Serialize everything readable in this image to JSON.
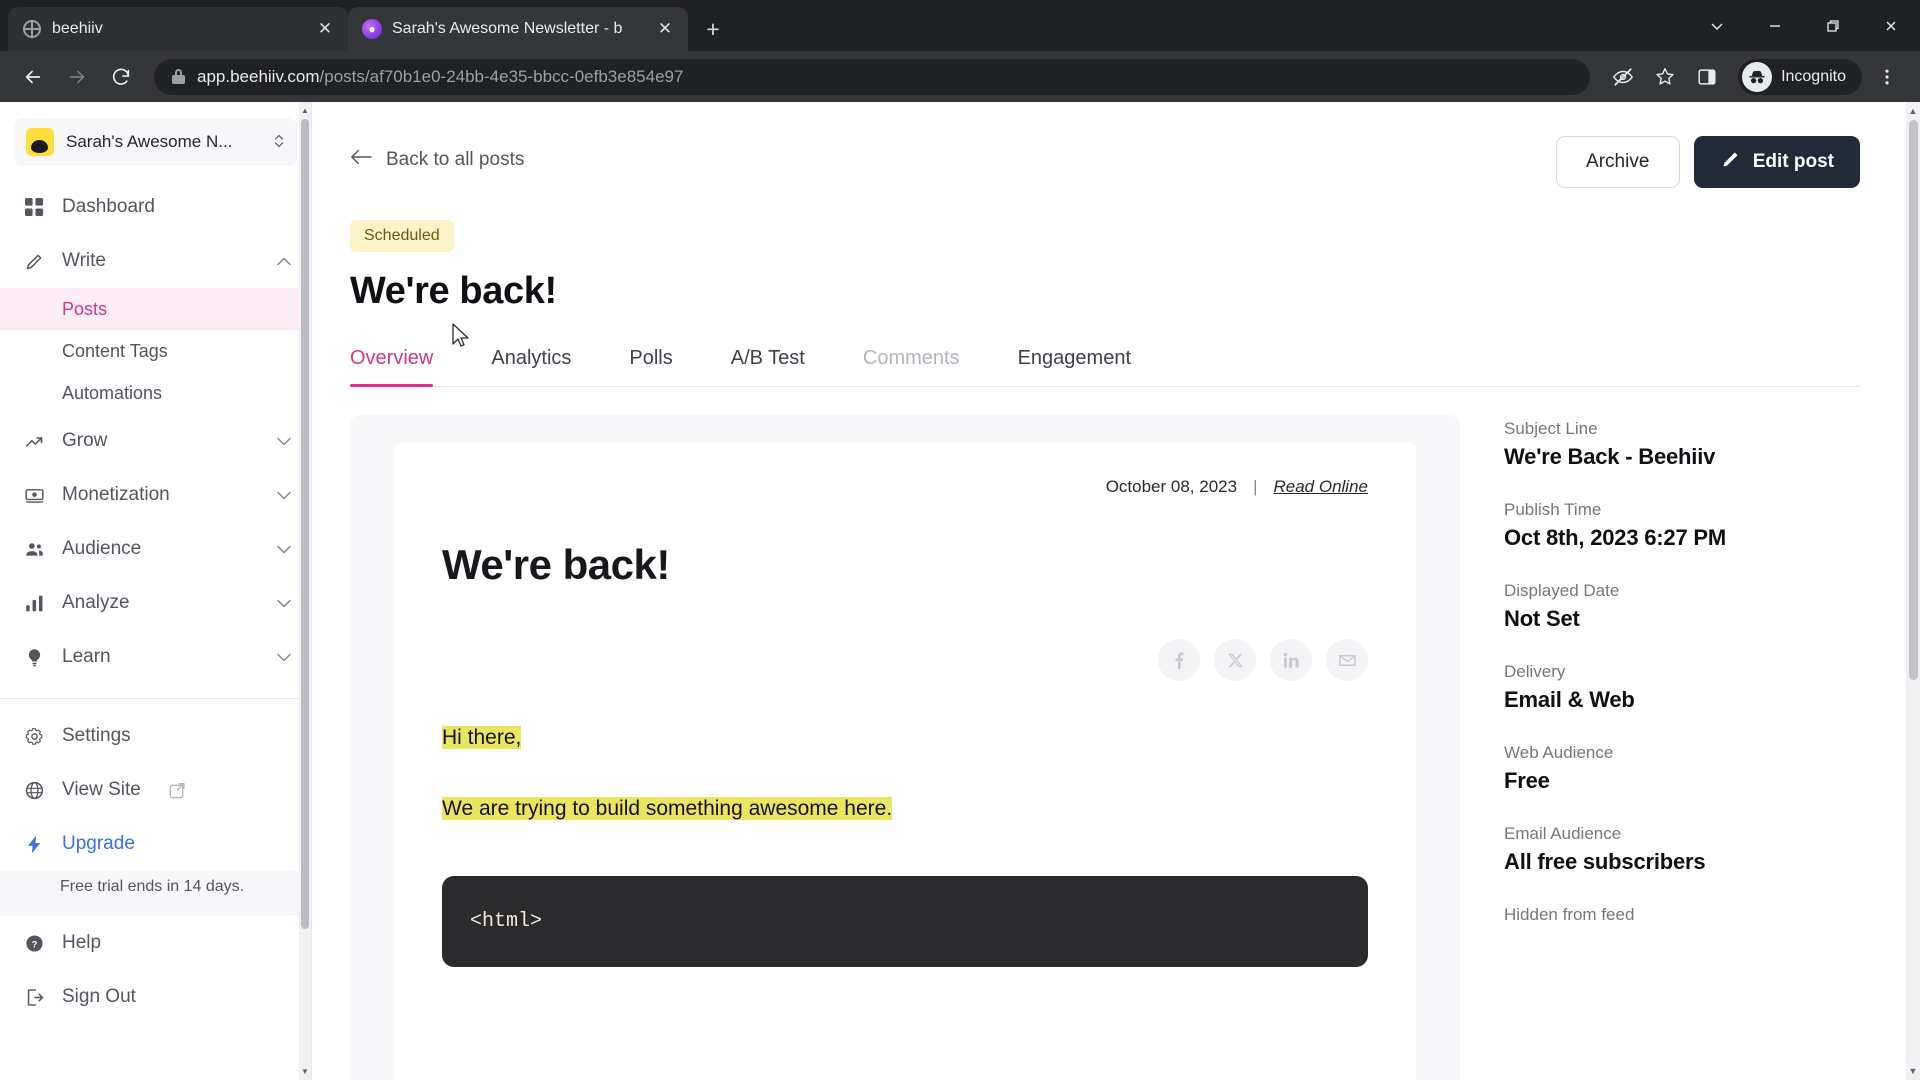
{
  "browser": {
    "tabs": [
      {
        "title": "beehiiv",
        "favicon": "globe-icon",
        "active": false
      },
      {
        "title": "Sarah's Awesome Newsletter - b",
        "favicon": "beehiiv-icon",
        "active": true
      }
    ],
    "new_tab_label": "+",
    "window_controls": [
      "chevron-down-icon",
      "minimize-icon",
      "restore-icon",
      "close-icon"
    ],
    "nav": {
      "back": "←",
      "forward": "→",
      "reload": "↻"
    },
    "address": {
      "security": "lock-icon",
      "host": "app.beehiiv.com",
      "path": "/posts/af70b1e0-24bb-4e35-bbcc-0efb3e854e97"
    },
    "toolbar_icons": [
      "eye-slash-icon",
      "bookmark-star-icon",
      "side-panel-icon"
    ],
    "profile": {
      "label": "Incognito",
      "icon": "incognito-icon"
    },
    "menu_icon": "three-dot-menu-icon"
  },
  "sidebar": {
    "workspace": {
      "name": "Sarah's Awesome N...",
      "logo": "beehiiv-bee-logo",
      "chevron": "⌃⌄"
    },
    "items": [
      {
        "label": "Dashboard",
        "icon": "grid-icon",
        "caret": ""
      },
      {
        "label": "Write",
        "icon": "pencil-icon",
        "caret": "⌃",
        "expanded": true
      },
      {
        "label": "Grow",
        "icon": "trending-up-icon",
        "caret": "⌄"
      },
      {
        "label": "Monetization",
        "icon": "money-icon",
        "caret": "⌄"
      },
      {
        "label": "Audience",
        "icon": "people-icon",
        "caret": "⌄"
      },
      {
        "label": "Analyze",
        "icon": "bar-chart-icon",
        "caret": "⌄"
      },
      {
        "label": "Learn",
        "icon": "lightbulb-icon",
        "caret": "⌄"
      }
    ],
    "write_subitems": [
      {
        "label": "Posts",
        "active": true
      },
      {
        "label": "Content Tags",
        "active": false
      },
      {
        "label": "Automations",
        "active": false
      }
    ],
    "footer_items": [
      {
        "label": "Settings",
        "icon": "gear-icon"
      },
      {
        "label": "View Site",
        "icon": "globe-icon",
        "external": "external-link-icon"
      },
      {
        "label": "Upgrade",
        "icon": "lightning-bolt-icon",
        "highlight": true
      }
    ],
    "trial_notice": "Free trial ends in 14 days.",
    "bottom_items": [
      {
        "label": "Help",
        "icon": "question-circle-icon"
      },
      {
        "label": "Sign Out",
        "icon": "logout-icon"
      }
    ]
  },
  "main": {
    "back_link": "Back to all posts",
    "back_icon": "arrow-left-icon",
    "actions": {
      "archive_label": "Archive",
      "edit_label": "Edit post",
      "edit_icon": "pencil-icon"
    },
    "status_badge": "Scheduled",
    "title": "We're back!",
    "tabs": [
      {
        "label": "Overview",
        "active": true,
        "disabled": false
      },
      {
        "label": "Analytics",
        "active": false,
        "disabled": false
      },
      {
        "label": "Polls",
        "active": false,
        "disabled": false
      },
      {
        "label": "A/B Test",
        "active": false,
        "disabled": false
      },
      {
        "label": "Comments",
        "active": false,
        "disabled": true
      },
      {
        "label": "Engagement",
        "active": false,
        "disabled": false
      }
    ]
  },
  "preview": {
    "date": "October 08, 2023",
    "separator": "|",
    "read_online": "Read Online",
    "headline": "We're back!",
    "social": [
      {
        "name": "facebook-icon",
        "glyph": "f"
      },
      {
        "name": "x-twitter-icon",
        "glyph": "✕"
      },
      {
        "name": "linkedin-icon",
        "glyph": "in"
      },
      {
        "name": "email-icon",
        "glyph": "✉"
      }
    ],
    "body": [
      "Hi there,",
      "We are trying to build something awesome here."
    ],
    "code": "<html>"
  },
  "meta": {
    "fields": [
      {
        "label": "Subject Line",
        "value": "We're Back - Beehiiv"
      },
      {
        "label": "Publish Time",
        "value": "Oct 8th, 2023 6:27 PM"
      },
      {
        "label": "Displayed Date",
        "value": "Not Set"
      },
      {
        "label": "Delivery",
        "value": "Email & Web"
      },
      {
        "label": "Web Audience",
        "value": "Free"
      },
      {
        "label": "Email Audience",
        "value": "All free subscribers"
      }
    ],
    "trailing_label": "Hidden from feed"
  },
  "colors": {
    "accent_pink": "#d6348b",
    "badge_bg": "#fdf3c8",
    "highlight_yellow": "#e9e55e",
    "dark_button": "#212a36",
    "upgrade_blue": "#3d6ee6"
  }
}
